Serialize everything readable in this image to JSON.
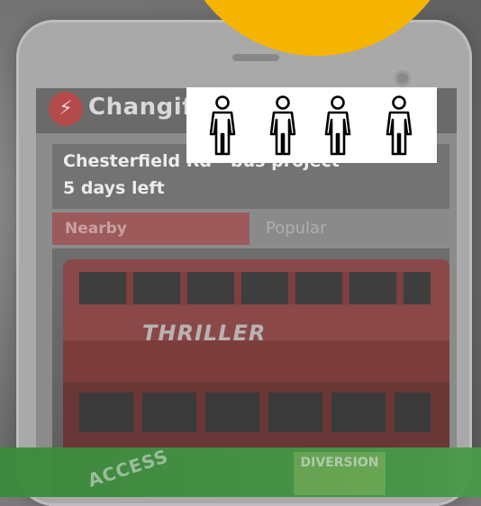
{
  "app": {
    "title": "Changify",
    "logo_icon": "lightning-bolt-icon"
  },
  "project": {
    "title": "Chesterfield Rd - bus project",
    "days_left": "5 days left"
  },
  "tabs": [
    {
      "label": "Nearby",
      "active": true
    },
    {
      "label": "Popular",
      "active": false
    }
  ],
  "photo": {
    "ad_text": "THRILLER",
    "sign_access": "ACCESS",
    "sign_diversion": "DIVERSION"
  },
  "people_icons": {
    "count": 4,
    "icon": "person-icon"
  },
  "colors": {
    "accent_orange": "#f4b400",
    "banner_green": "#4a9a4a",
    "nearby_tab": "#9c5a5a"
  }
}
